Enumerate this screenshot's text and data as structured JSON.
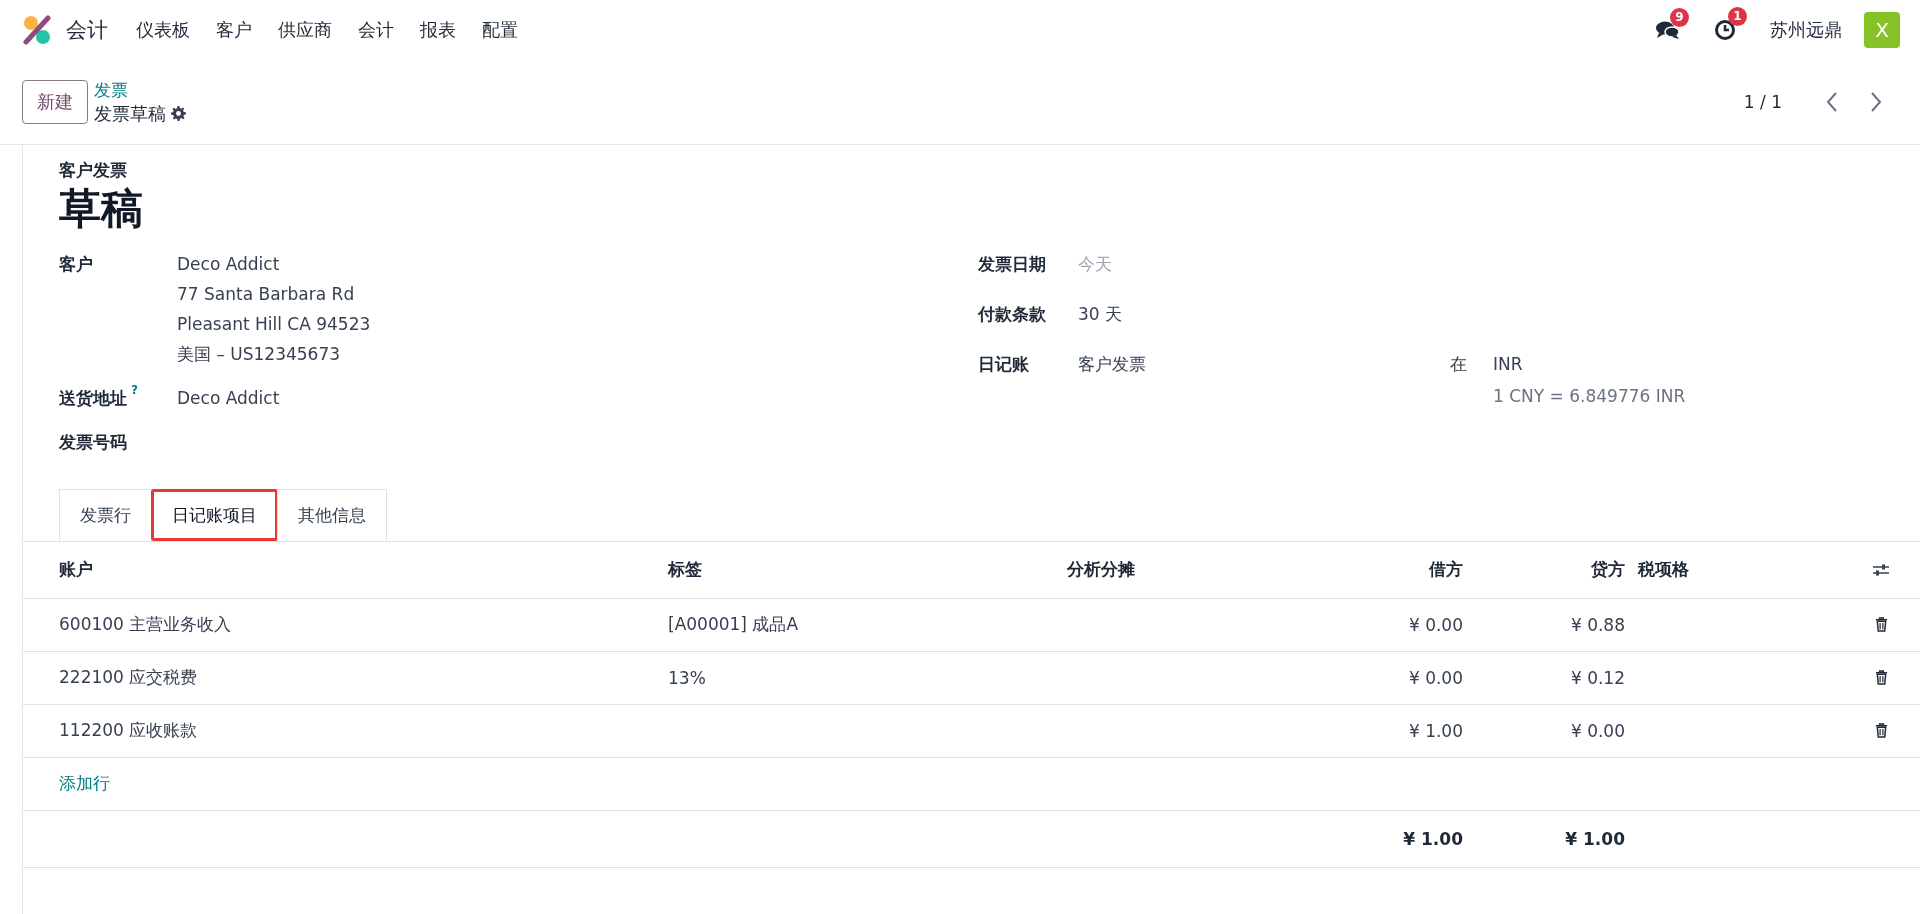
{
  "app_nav": {
    "app_name": "会计",
    "menu": [
      "仪表板",
      "客户",
      "供应商",
      "会计",
      "报表",
      "配置"
    ],
    "messages_badge": "9",
    "activities_badge": "1",
    "company": "苏州远鼎",
    "avatar": "X"
  },
  "control_panel": {
    "new_button": "新建",
    "breadcrumb": "发票",
    "record_title": "发票草稿",
    "pager": "1 / 1"
  },
  "form": {
    "move_type": "客户发票",
    "status": "草稿",
    "left_fields": [
      {
        "label": "客户",
        "lines": [
          "Deco Addict",
          "77 Santa Barbara Rd",
          "Pleasant Hill CA 94523",
          "美国 – US12345673"
        ]
      },
      {
        "label": "送货地址",
        "help": "?",
        "lines": [
          "Deco Addict"
        ]
      },
      {
        "label": "发票号码"
      }
    ],
    "right_fields": [
      {
        "label": "发票日期",
        "placeholder": "今天"
      },
      {
        "label": "付款条款",
        "value": "30 天"
      },
      {
        "label": "日记账",
        "value": "客户发票",
        "currency_prefix": "在",
        "currency": "INR",
        "rate": "1 CNY = 6.849776 INR"
      }
    ]
  },
  "tabs": [
    {
      "label": "发票行",
      "selected": false
    },
    {
      "label": "日记账项目",
      "selected": true
    },
    {
      "label": "其他信息",
      "selected": false
    }
  ],
  "table": {
    "columns": [
      "账户",
      "标签",
      "分析分摊",
      "借方",
      "贷方",
      "税项格"
    ],
    "rows": [
      {
        "account": "600100 主营业务收入",
        "label": "[A00001] 成品A",
        "debit": "¥ 0.00",
        "credit": "¥ 0.88"
      },
      {
        "account": "222100 应交税费",
        "label": "13%",
        "debit": "¥ 0.00",
        "credit": "¥ 0.12"
      },
      {
        "account": "112200 应收账款",
        "debit": "¥ 1.00",
        "credit": "¥ 0.00"
      }
    ],
    "add_line": "添加行",
    "totals": {
      "debit": "¥ 1.00",
      "credit": "¥ 1.00"
    }
  }
}
